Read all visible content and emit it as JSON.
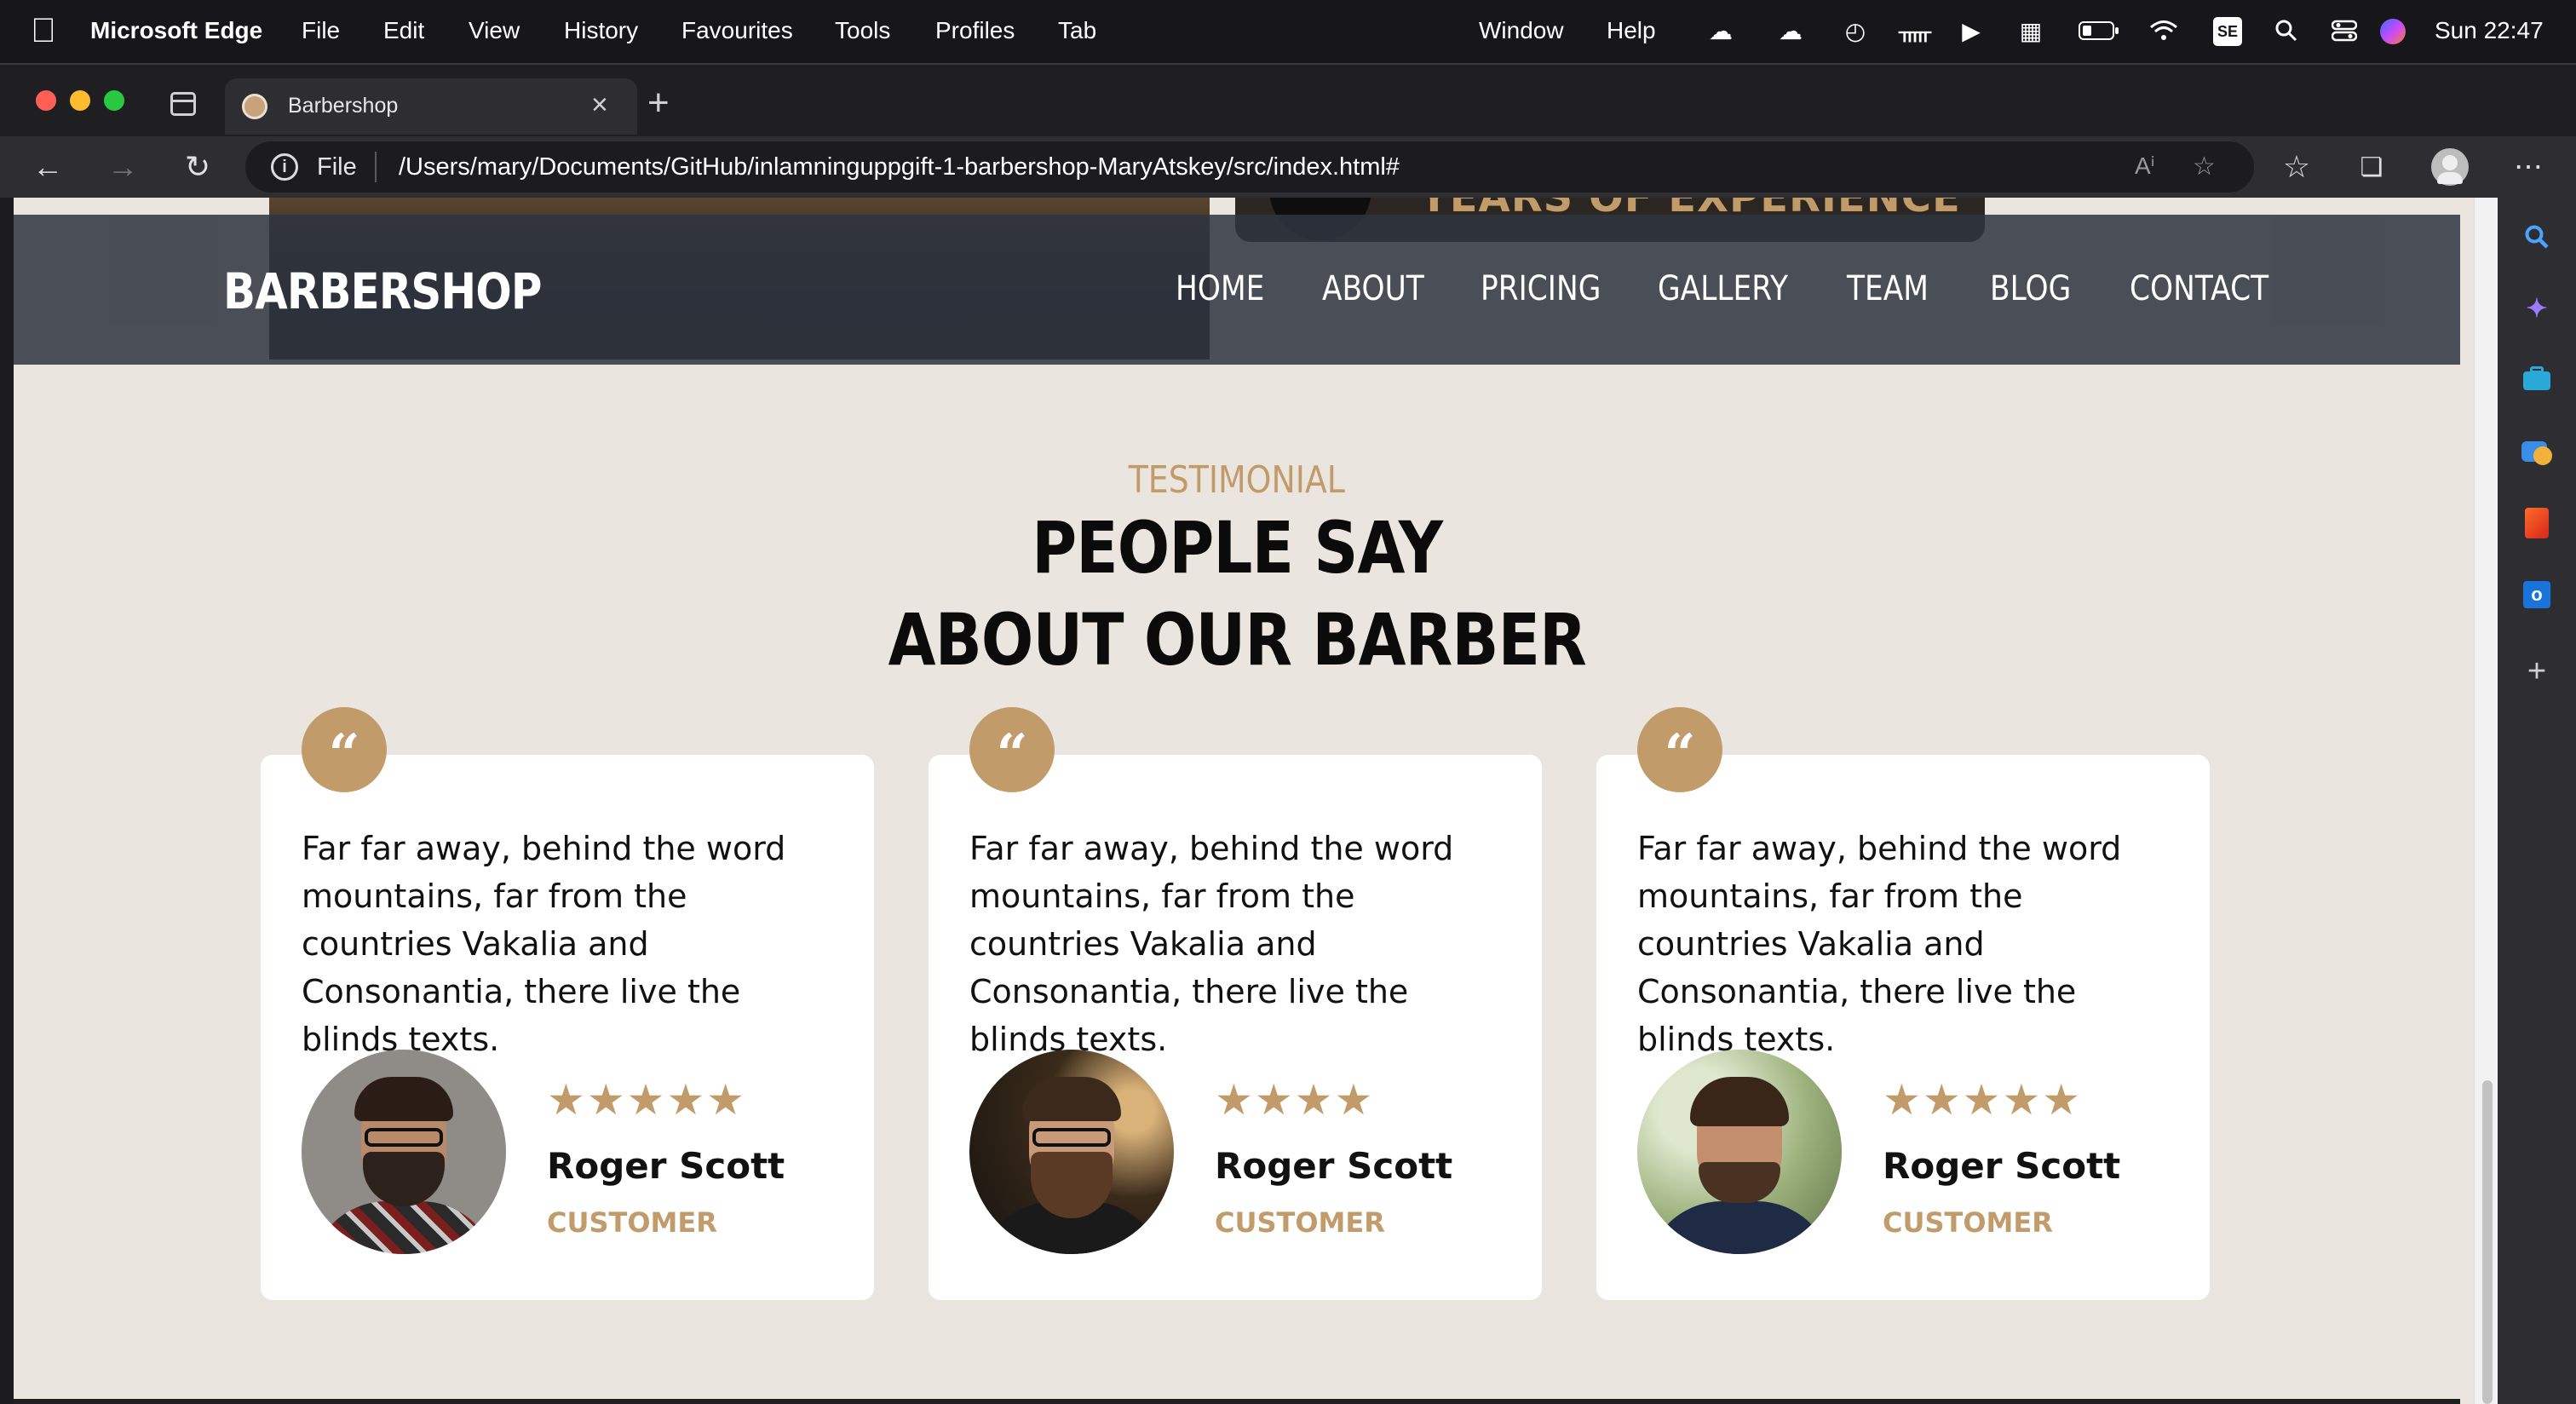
{
  "menubar": {
    "app_name": "Microsoft Edge",
    "items": [
      "File",
      "Edit",
      "View",
      "History",
      "Favourites",
      "Tools",
      "Profiles",
      "Tab",
      "Window",
      "Help"
    ],
    "status_icons": [
      "creative-cloud-icon",
      "icloud-icon",
      "time-machine-icon",
      "bluetooth-icon",
      "play-icon",
      "bed-icon",
      "battery-icon",
      "wifi-icon",
      "input-source-icon",
      "spotlight-icon",
      "control-center-icon",
      "siri-icon"
    ],
    "input_source": "SE",
    "clock": "Sun  22:47"
  },
  "browser": {
    "tab_title": "Barbershop",
    "address_scheme": "File",
    "url": "/Users/mary/Documents/GitHub/inlamninguppgift-1-barbershop-MaryAtskey/src/index.html#"
  },
  "sidebar": {
    "icons": [
      "search-icon",
      "copilot-icon",
      "tools-icon",
      "games-icon",
      "office-icon",
      "outlook-icon",
      "add-icon"
    ]
  },
  "page": {
    "hero_badge_text": "YEARS OF EXPERIENCE",
    "logo": "BARBERSHOP",
    "nav": [
      "HOME",
      "ABOUT",
      "PRICING",
      "GALLERY",
      "TEAM",
      "BLOG",
      "CONTACT"
    ],
    "testimonial": {
      "eyebrow": "TESTIMONIAL",
      "heading_line1": "PEOPLE SAY",
      "heading_line2": "ABOUT OUR BARBER",
      "cards": [
        {
          "text": "Far far away, behind the word mountains, far from the countries Vakalia and Consonantia, there live the blinds texts.",
          "rating": 5,
          "stars": "★★★★★",
          "name": "Roger Scott",
          "role": "CUSTOMER"
        },
        {
          "text": "Far far away, behind the word mountains, far from the countries Vakalia and Consonantia, there live the blinds texts.",
          "rating": 4,
          "stars": "★★★★",
          "name": "Roger Scott",
          "role": "CUSTOMER"
        },
        {
          "text": "Far far away, behind the word mountains, far from the countries Vakalia and Consonantia, there live the blinds texts.",
          "rating": 5,
          "stars": "★★★★★",
          "name": "Roger Scott",
          "role": "CUSTOMER"
        }
      ]
    }
  },
  "colors": {
    "accent": "#c29b6a",
    "page_background": "#eae6df",
    "navbar": "#2e3440",
    "card": "#ffffff"
  }
}
